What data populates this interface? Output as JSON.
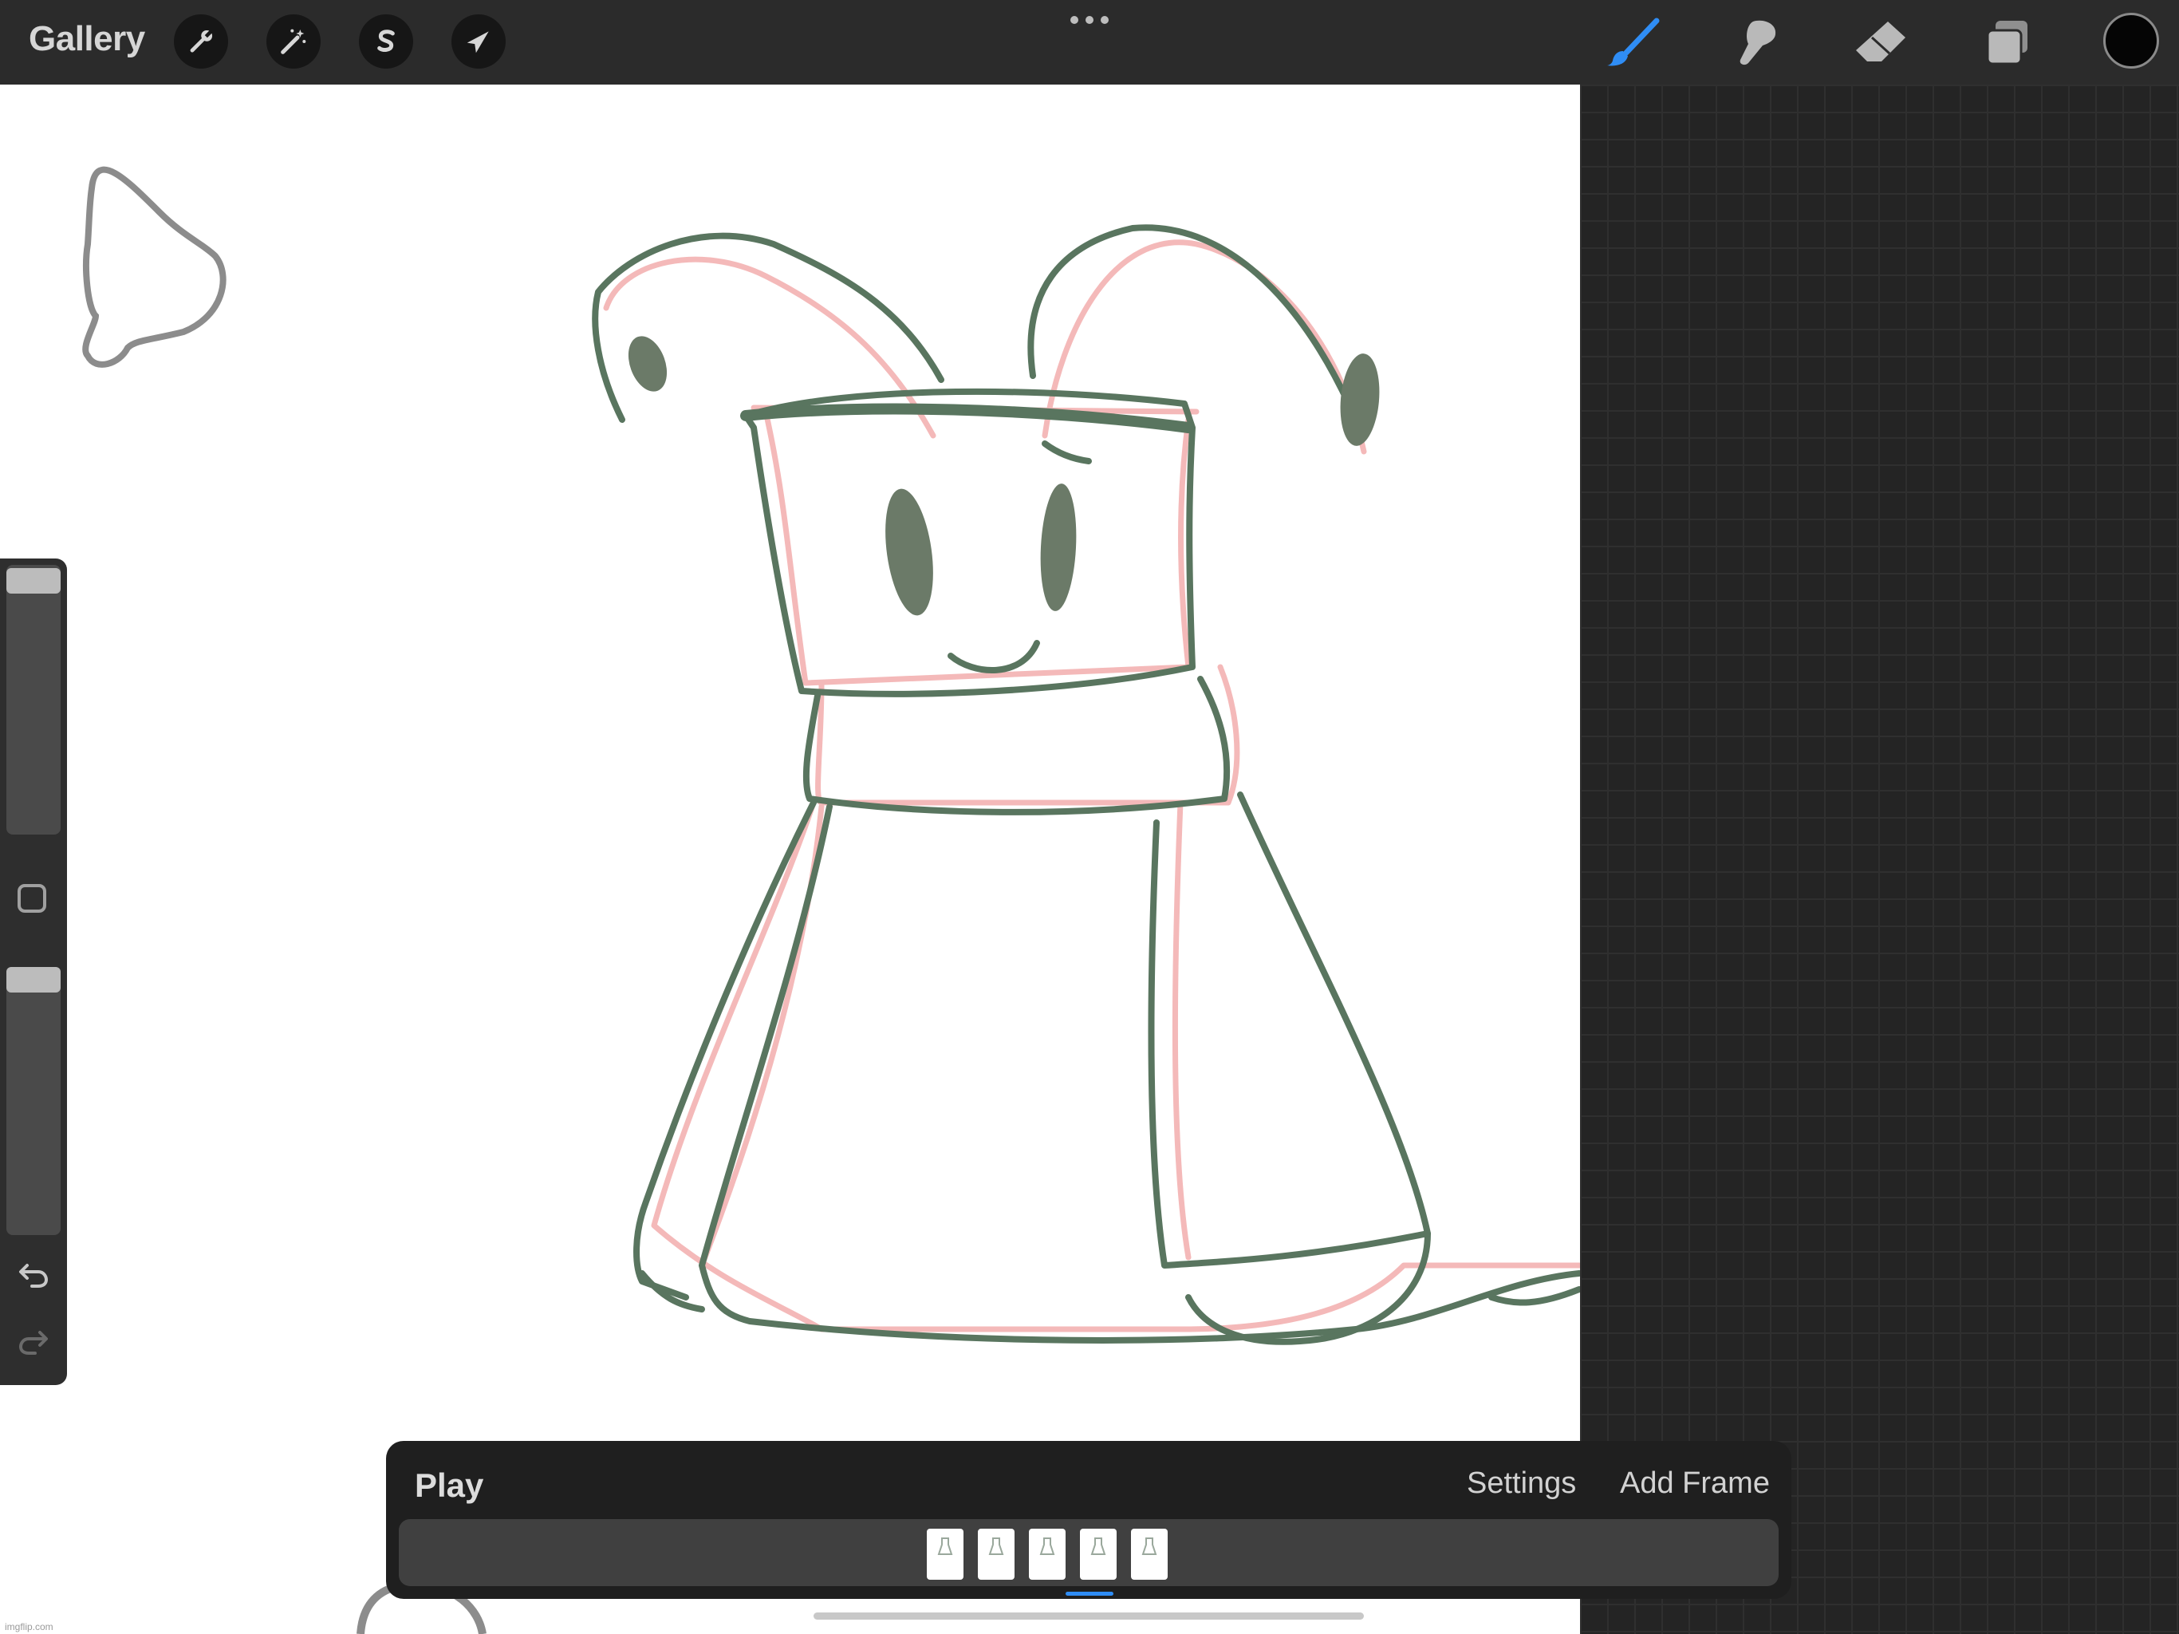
{
  "topbar": {
    "gallery_label": "Gallery",
    "left_tools": [
      {
        "name": "actions",
        "icon": "wrench-icon"
      },
      {
        "name": "adjustments",
        "icon": "magic-wand-icon"
      },
      {
        "name": "selection",
        "icon": "selection-s-icon"
      },
      {
        "name": "transform",
        "icon": "arrow-cursor-icon"
      }
    ],
    "right_tools": [
      {
        "name": "brush",
        "icon": "brush-icon",
        "active": true
      },
      {
        "name": "smudge",
        "icon": "smudge-icon"
      },
      {
        "name": "eraser",
        "icon": "eraser-icon"
      },
      {
        "name": "layers",
        "icon": "layers-icon"
      }
    ],
    "current_color": "#050505",
    "accent_color": "#2f8df5"
  },
  "sidebar": {
    "brush_size_level": 0.95,
    "opacity_level": 0.96,
    "undo_icon": "undo-arrow-icon",
    "redo_icon": "redo-arrow-icon"
  },
  "animation": {
    "play_label": "Play",
    "settings_label": "Settings",
    "add_frame_label": "Add Frame",
    "frame_count": 5,
    "selected_frame": 4
  },
  "watermark": "imgflip.com"
}
